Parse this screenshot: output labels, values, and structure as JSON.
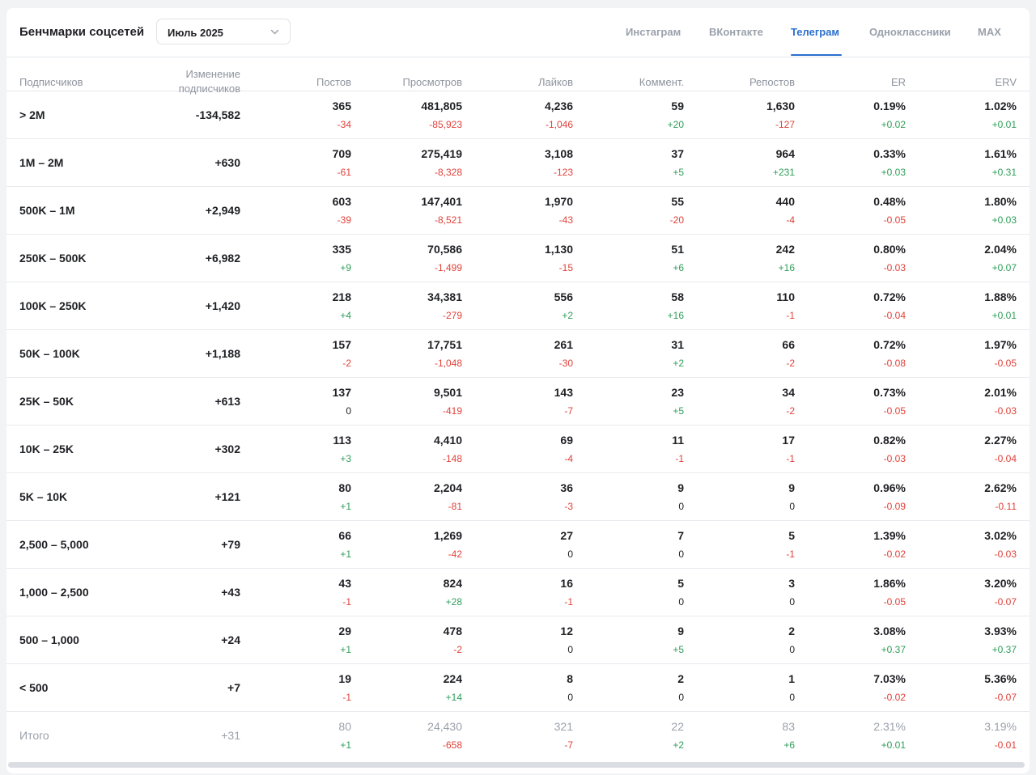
{
  "header": {
    "title": "Бенчмарки соцсетей",
    "period_value": "Июль 2025",
    "tabs": [
      {
        "label": "Инстаграм",
        "active": false
      },
      {
        "label": "ВКонтакте",
        "active": false
      },
      {
        "label": "Телеграм",
        "active": true
      },
      {
        "label": "Одноклассники",
        "active": false
      },
      {
        "label": "MAX",
        "active": false
      }
    ]
  },
  "colors": {
    "accent": "#2c6fcf",
    "negative": "#e0413a",
    "positive": "#2f9e5a"
  },
  "table": {
    "columns": {
      "subscribers": "Подписчиков",
      "change_line1": "Изменение",
      "change_line2": "подписчиков",
      "posts": "Постов",
      "views": "Просмотров",
      "likes": "Лайков",
      "comments": "Коммент.",
      "reposts": "Репостов",
      "er": "ER",
      "erv": "ERV"
    },
    "rows": [
      {
        "label": "> 2M",
        "change": "-134,582",
        "m": [
          [
            "365",
            "-34"
          ],
          [
            "481,805",
            "-85,923"
          ],
          [
            "4,236",
            "-1,046"
          ],
          [
            "59",
            "+20"
          ],
          [
            "1,630",
            "-127"
          ],
          [
            "0.19%",
            "+0.02"
          ],
          [
            "1.02%",
            "+0.01"
          ]
        ]
      },
      {
        "label": "1M – 2M",
        "change": "+630",
        "m": [
          [
            "709",
            "-61"
          ],
          [
            "275,419",
            "-8,328"
          ],
          [
            "3,108",
            "-123"
          ],
          [
            "37",
            "+5"
          ],
          [
            "964",
            "+231"
          ],
          [
            "0.33%",
            "+0.03"
          ],
          [
            "1.61%",
            "+0.31"
          ]
        ]
      },
      {
        "label": "500K – 1M",
        "change": "+2,949",
        "m": [
          [
            "603",
            "-39"
          ],
          [
            "147,401",
            "-8,521"
          ],
          [
            "1,970",
            "-43"
          ],
          [
            "55",
            "-20"
          ],
          [
            "440",
            "-4"
          ],
          [
            "0.48%",
            "-0.05"
          ],
          [
            "1.80%",
            "+0.03"
          ]
        ]
      },
      {
        "label": "250K – 500K",
        "change": "+6,982",
        "m": [
          [
            "335",
            "+9"
          ],
          [
            "70,586",
            "-1,499"
          ],
          [
            "1,130",
            "-15"
          ],
          [
            "51",
            "+6"
          ],
          [
            "242",
            "+16"
          ],
          [
            "0.80%",
            "-0.03"
          ],
          [
            "2.04%",
            "+0.07"
          ]
        ]
      },
      {
        "label": "100K – 250K",
        "change": "+1,420",
        "m": [
          [
            "218",
            "+4"
          ],
          [
            "34,381",
            "-279"
          ],
          [
            "556",
            "+2"
          ],
          [
            "58",
            "+16"
          ],
          [
            "110",
            "-1"
          ],
          [
            "0.72%",
            "-0.04"
          ],
          [
            "1.88%",
            "+0.01"
          ]
        ]
      },
      {
        "label": "50K – 100K",
        "change": "+1,188",
        "m": [
          [
            "157",
            "-2"
          ],
          [
            "17,751",
            "-1,048"
          ],
          [
            "261",
            "-30"
          ],
          [
            "31",
            "+2"
          ],
          [
            "66",
            "-2"
          ],
          [
            "0.72%",
            "-0.08"
          ],
          [
            "1.97%",
            "-0.05"
          ]
        ]
      },
      {
        "label": "25K – 50K",
        "change": "+613",
        "m": [
          [
            "137",
            "0"
          ],
          [
            "9,501",
            "-419"
          ],
          [
            "143",
            "-7"
          ],
          [
            "23",
            "+5"
          ],
          [
            "34",
            "-2"
          ],
          [
            "0.73%",
            "-0.05"
          ],
          [
            "2.01%",
            "-0.03"
          ]
        ]
      },
      {
        "label": "10K – 25K",
        "change": "+302",
        "m": [
          [
            "113",
            "+3"
          ],
          [
            "4,410",
            "-148"
          ],
          [
            "69",
            "-4"
          ],
          [
            "11",
            "-1"
          ],
          [
            "17",
            "-1"
          ],
          [
            "0.82%",
            "-0.03"
          ],
          [
            "2.27%",
            "-0.04"
          ]
        ]
      },
      {
        "label": "5K – 10K",
        "change": "+121",
        "m": [
          [
            "80",
            "+1"
          ],
          [
            "2,204",
            "-81"
          ],
          [
            "36",
            "-3"
          ],
          [
            "9",
            "0"
          ],
          [
            "9",
            "0"
          ],
          [
            "0.96%",
            "-0.09"
          ],
          [
            "2.62%",
            "-0.11"
          ]
        ]
      },
      {
        "label": "2,500 – 5,000",
        "change": "+79",
        "m": [
          [
            "66",
            "+1"
          ],
          [
            "1,269",
            "-42"
          ],
          [
            "27",
            "0"
          ],
          [
            "7",
            "0"
          ],
          [
            "5",
            "-1"
          ],
          [
            "1.39%",
            "-0.02"
          ],
          [
            "3.02%",
            "-0.03"
          ]
        ]
      },
      {
        "label": "1,000 – 2,500",
        "change": "+43",
        "m": [
          [
            "43",
            "-1"
          ],
          [
            "824",
            "+28"
          ],
          [
            "16",
            "-1"
          ],
          [
            "5",
            "0"
          ],
          [
            "3",
            "0"
          ],
          [
            "1.86%",
            "-0.05"
          ],
          [
            "3.20%",
            "-0.07"
          ]
        ]
      },
      {
        "label": "500 – 1,000",
        "change": "+24",
        "m": [
          [
            "29",
            "+1"
          ],
          [
            "478",
            "-2"
          ],
          [
            "12",
            "0"
          ],
          [
            "9",
            "+5"
          ],
          [
            "2",
            "0"
          ],
          [
            "3.08%",
            "+0.37"
          ],
          [
            "3.93%",
            "+0.37"
          ]
        ]
      },
      {
        "label": "< 500",
        "change": "+7",
        "m": [
          [
            "19",
            "-1"
          ],
          [
            "224",
            "+14"
          ],
          [
            "8",
            "0"
          ],
          [
            "2",
            "0"
          ],
          [
            "1",
            "0"
          ],
          [
            "7.03%",
            "-0.02"
          ],
          [
            "5.36%",
            "-0.07"
          ]
        ]
      }
    ],
    "total": {
      "label": "Итого",
      "change": "+31",
      "m": [
        [
          "80",
          "+1"
        ],
        [
          "24,430",
          "-658"
        ],
        [
          "321",
          "-7"
        ],
        [
          "22",
          "+2"
        ],
        [
          "83",
          "+6"
        ],
        [
          "2.31%",
          "+0.01"
        ],
        [
          "3.19%",
          "-0.01"
        ]
      ]
    }
  }
}
